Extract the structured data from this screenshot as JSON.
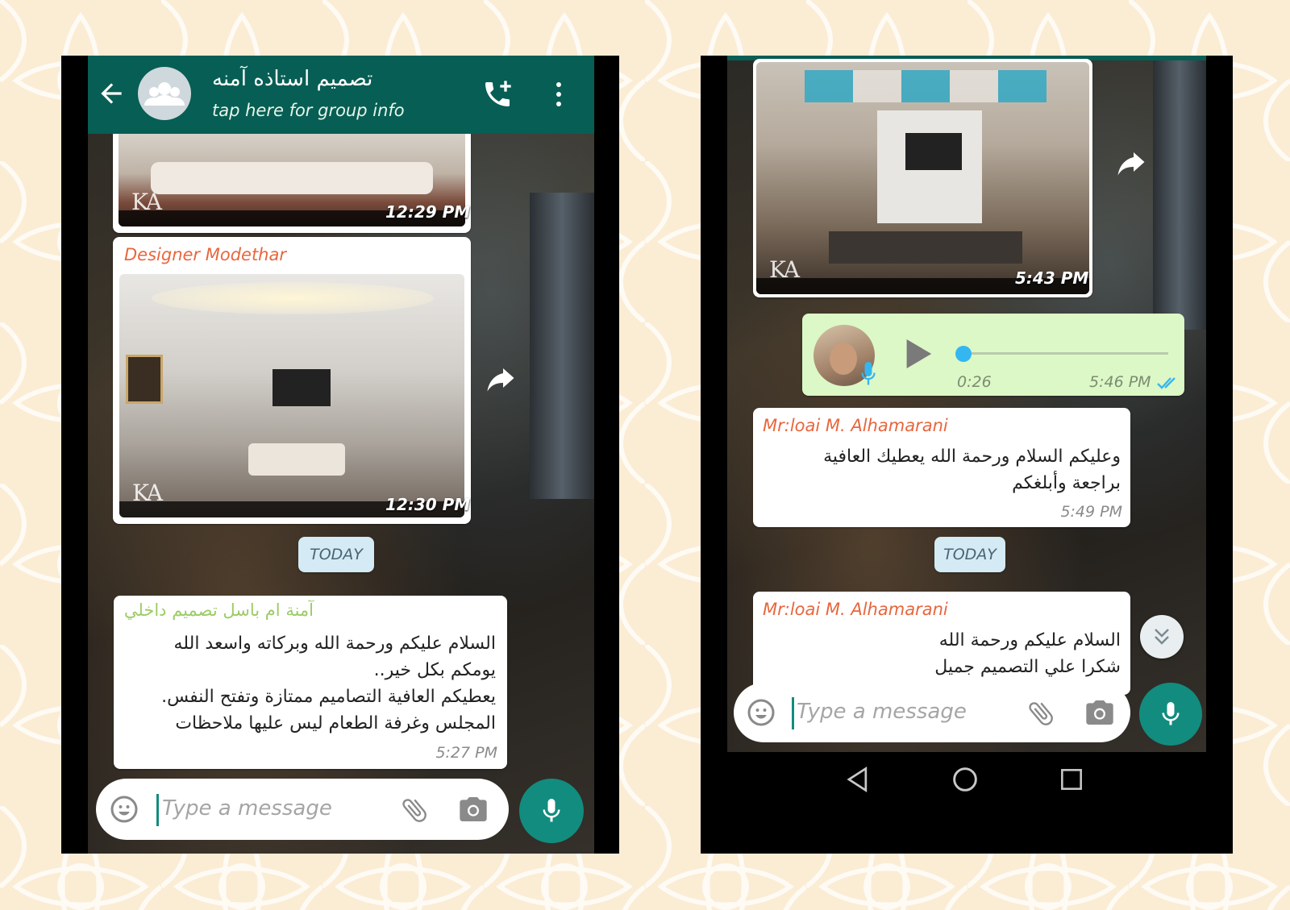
{
  "left_chat": {
    "header": {
      "title": "تصميم استاذه آمنه",
      "subtitle": "tap here for group info"
    },
    "messages": [
      {
        "type": "image",
        "time": "12:29 PM"
      },
      {
        "type": "image",
        "sender": "Designer Modethar",
        "time": "12:30 PM"
      },
      {
        "type": "divider",
        "text": "TODAY"
      },
      {
        "type": "text",
        "sender": "آمنة ام باسل تصميم داخلي",
        "lines": [
          "السلام عليكم ورحمة الله وبركاته واسعد الله",
          "يومكم بكل خير..",
          "يعطيكم العافية التصاميم ممتازة وتفتح النفس.",
          "المجلس وغرفة الطعام ليس عليها ملاحظات"
        ],
        "time": "5:27 PM"
      }
    ],
    "input": {
      "placeholder": "Type a message"
    }
  },
  "right_chat": {
    "messages": [
      {
        "type": "image",
        "time": "5:43 PM"
      },
      {
        "type": "voice",
        "duration": "0:26",
        "time": "5:46 PM",
        "status": "read",
        "progress": 0.02
      },
      {
        "type": "text",
        "sender": "Mr:loai M. Alhamarani",
        "lines": [
          "وعليكم السلام ورحمة الله يعطيك العافية",
          "براجعة وأبلغكم"
        ],
        "time": "5:49 PM"
      },
      {
        "type": "divider",
        "text": "TODAY"
      },
      {
        "type": "text",
        "sender": "Mr:loai M. Alhamarani",
        "lines": [
          "السلام عليكم ورحمة الله",
          "شكرا علي التصميم جميل"
        ]
      }
    ],
    "input": {
      "placeholder": "Type a message"
    }
  },
  "icons": {
    "back": "arrow-left-icon",
    "group_avatar": "group-avatar-icon",
    "call": "add-call-icon",
    "menu": "more-vert-icon",
    "forward": "forward-icon",
    "emoji": "emoji-icon",
    "attach": "paperclip-icon",
    "camera": "camera-icon",
    "mic": "mic-icon",
    "play": "play-icon",
    "read": "double-check-icon",
    "scroll_down": "double-chevron-down-icon",
    "nav_back": "nav-back-icon",
    "nav_home": "nav-home-icon",
    "nav_recents": "nav-recents-icon"
  },
  "colors": {
    "header": "#075e54",
    "accent": "#128c7e",
    "outgoing_bubble": "#dcf8c6",
    "sender_orange": "#e8663d",
    "sender_green": "#9ccc65",
    "today_chip": "#d4eaf4",
    "tick_blue": "#34b7f1"
  }
}
